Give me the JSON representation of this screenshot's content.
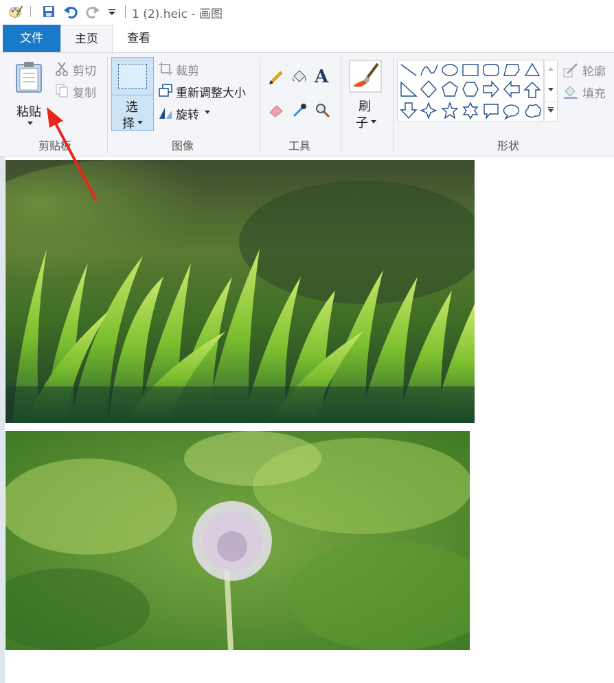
{
  "window": {
    "title": "1 (2).heic - 画图"
  },
  "tabs": [
    {
      "label": "文件"
    },
    {
      "label": "主页"
    },
    {
      "label": "查看"
    }
  ],
  "clipboard": {
    "paste_label": "粘贴",
    "cut_label": "剪切",
    "copy_label": "复制",
    "group_label": "剪贴板"
  },
  "image_group": {
    "select_label_1": "选",
    "select_label_2": "择",
    "crop_label": "裁剪",
    "resize_label": "重新调整大小",
    "rotate_label": "旋转",
    "group_label": "图像"
  },
  "tools_group": {
    "group_label": "工具"
  },
  "brushes": {
    "label_1": "刷",
    "label_2": "子",
    "group_label": ""
  },
  "shapes_group": {
    "outline_label": "轮廓",
    "fill_label": "填充",
    "group_label": "形状"
  },
  "colors": {
    "accent": "#1979ca",
    "ribbon_bg": "#f3f5f8",
    "arrow": "#e8261c"
  }
}
